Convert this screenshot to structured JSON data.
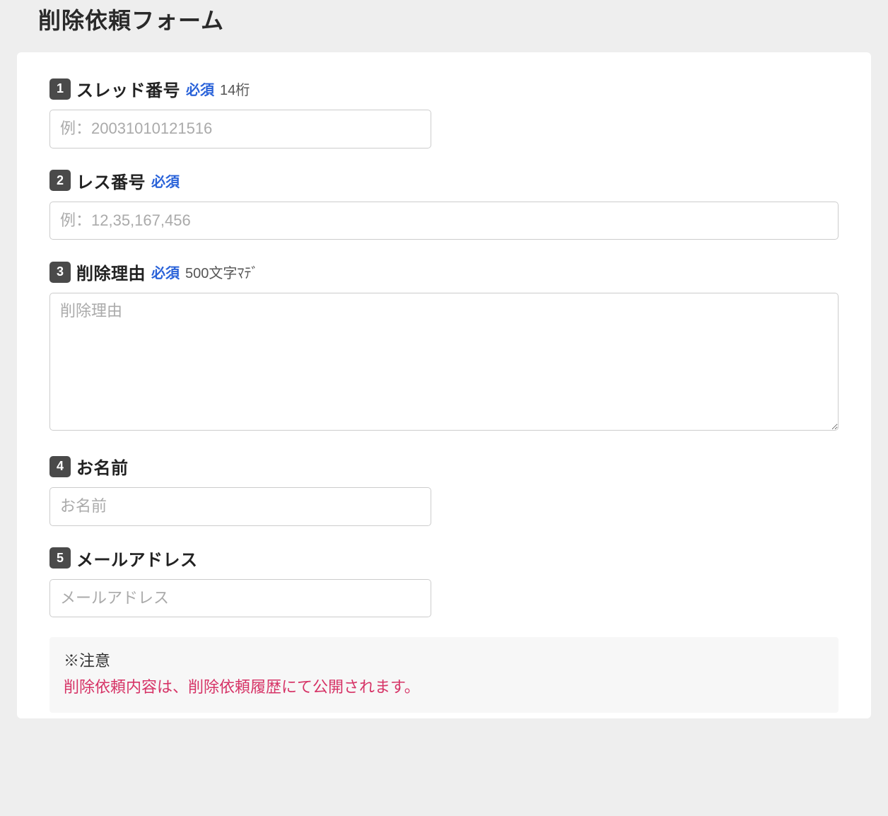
{
  "page": {
    "title": "削除依頼フォーム"
  },
  "fields": {
    "thread": {
      "num": "1",
      "label": "スレッド番号",
      "required": "必須",
      "hint": "14桁",
      "placeholder": "例：20031010121516"
    },
    "res": {
      "num": "2",
      "label": "レス番号",
      "required": "必須",
      "placeholder": "例：12,35,167,456"
    },
    "reason": {
      "num": "3",
      "label": "削除理由",
      "required": "必須",
      "hint": "500文字ﾏﾃﾞ",
      "placeholder": "削除理由"
    },
    "name": {
      "num": "4",
      "label": "お名前",
      "placeholder": "お名前"
    },
    "email": {
      "num": "5",
      "label": "メールアドレス",
      "placeholder": "メールアドレス"
    }
  },
  "notice": {
    "heading": "※注意",
    "warning": "削除依頼内容は、削除依頼履歴にて公開されます。"
  }
}
